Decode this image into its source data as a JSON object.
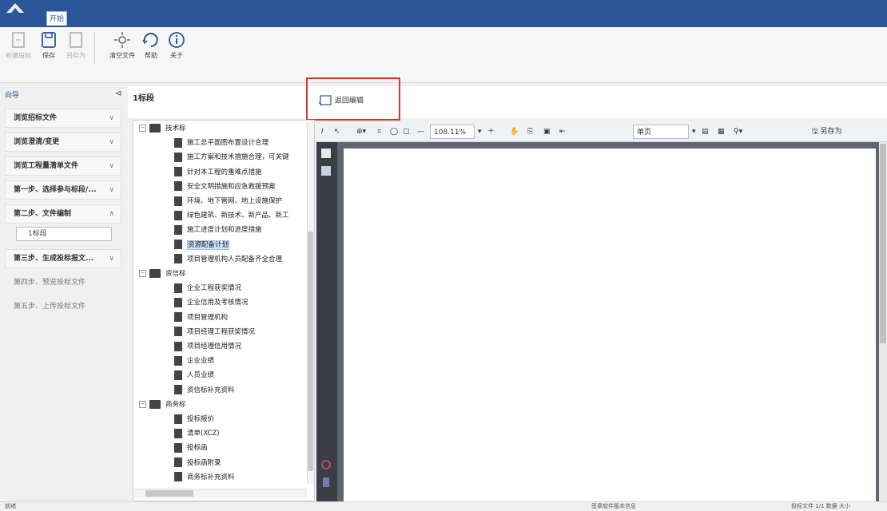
{
  "ribbon": {
    "tab": "开始",
    "buttons": [
      {
        "label": "新建投标",
        "icon": "new-bid-icon",
        "enabled": false
      },
      {
        "label": "保存",
        "icon": "save-icon",
        "enabled": true
      },
      {
        "label": "另存为",
        "icon": "save-as-icon",
        "enabled": false
      },
      {
        "label": "清空文件",
        "icon": "clear-file-icon",
        "enabled": true
      },
      {
        "label": "帮助",
        "icon": "help-icon",
        "enabled": true
      },
      {
        "label": "关于",
        "icon": "about-icon",
        "enabled": true
      }
    ]
  },
  "left_panel": {
    "title": "向导",
    "steps": [
      {
        "label": "浏览招标文件",
        "chevron": "∨"
      },
      {
        "label": "浏览澄清/变更",
        "chevron": "∨"
      },
      {
        "label": "浏览工程量清单文件",
        "chevron": "∨"
      },
      {
        "label": "第一步、选择参与标段/...",
        "chevron": "∨"
      },
      {
        "label": "第二步、文件编制",
        "chevron": "∧"
      },
      {
        "label": "第三步、生成投标报文...",
        "chevron": "∨"
      },
      {
        "label": "第四步、预览投标文件",
        "chevron": ""
      },
      {
        "label": "第五步、上传投标文件",
        "chevron": ""
      }
    ],
    "input_value": "1标段"
  },
  "center": {
    "title": "1标段",
    "return_edit_label": "返回编辑"
  },
  "tree": {
    "groups": [
      {
        "label": "技术标",
        "items": [
          "施工总平面图布置设计合理",
          "施工方案和技术措施合理，可关键",
          "针对本工程的重难点措施",
          "安全文明措施和应急救援预案",
          "环境、地下管网、地上设施保护",
          "绿色建筑、新技术、新产品、新工",
          "施工进度计划和进度措施",
          "资源配备计划",
          "项目管理机构人员配备齐全合理"
        ],
        "selected_index": 7
      },
      {
        "label": "资信标",
        "items": [
          "企业工程获奖情况",
          "企业信用及考核情况",
          "项目管理机构",
          "项目经理工程获奖情况",
          "项目经理信用情况",
          "企业业绩",
          "人员业绩",
          "资信标补充资料"
        ],
        "selected_index": -1
      },
      {
        "label": "商务标",
        "items": [
          "投标报价",
          "清单(XCZ)",
          "投标函",
          "投标函附录",
          "商务标补充资料"
        ],
        "selected_index": -1
      }
    ]
  },
  "viewer": {
    "zoom": "108.11%",
    "mode_select": "单页",
    "save_label": "另存为"
  },
  "statusbar": {
    "left": "就绪",
    "center": "签章软件版本信息",
    "right": "投标文件   1/1   数据   大小"
  },
  "colors": {
    "title_bar": "#2b579a",
    "highlight_box": "#e0322b",
    "selection": "#cde3f7"
  }
}
